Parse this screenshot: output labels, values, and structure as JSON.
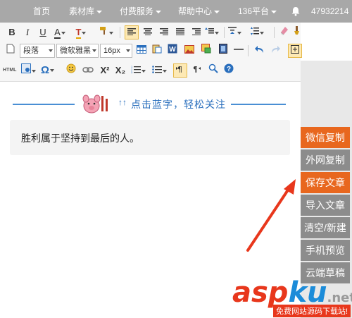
{
  "topnav": {
    "items": [
      {
        "label": "首页",
        "has_dropdown": false
      },
      {
        "label": "素材库",
        "has_dropdown": true
      },
      {
        "label": "付费服务",
        "has_dropdown": true
      },
      {
        "label": "帮助中心",
        "has_dropdown": true
      },
      {
        "label": "136平台",
        "has_dropdown": true
      }
    ],
    "user_id": "47932214"
  },
  "toolbar": {
    "row1": [
      "B",
      "I",
      "U",
      "A",
      "T"
    ],
    "paragraph_select": "段落",
    "font_select": "微软雅黑",
    "size_select": "16px",
    "row3": [
      "HTML",
      "Ω",
      "X²",
      "X₂"
    ]
  },
  "editor": {
    "banner_text": "点击蓝字，轻松关注",
    "banner_arrows": "↑↑",
    "content_text": "胜利属于坚持到最后的人。"
  },
  "side_buttons": [
    {
      "label": "微信复制",
      "color": "#e8671e"
    },
    {
      "label": "外网复制",
      "color": "#8c8c8c"
    },
    {
      "label": "保存文章",
      "color": "#e8671e"
    },
    {
      "label": "导入文章",
      "color": "#8c8c8c"
    },
    {
      "label": "清空/新建",
      "color": "#8c8c8c"
    },
    {
      "label": "手机预览",
      "color": "#8c8c8c"
    },
    {
      "label": "云端草稿",
      "color": "#8c8c8c"
    }
  ],
  "watermark": {
    "asp": "asp",
    "ku": "ku",
    "net": ".net",
    "subtitle": "免费网站源码下载站!"
  },
  "colors": {
    "accent_orange": "#e8671e",
    "annotation_red": "#e8371c",
    "banner_blue": "#4a8fd4"
  }
}
